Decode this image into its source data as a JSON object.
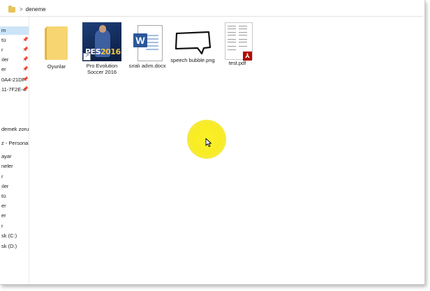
{
  "address": {
    "breadcrumb_separator": ">",
    "current_folder": "deneme"
  },
  "sidebar": {
    "items": [
      {
        "label": "m",
        "selected": true,
        "pinned": false
      },
      {
        "label": "tü",
        "pinned": true
      },
      {
        "label": "r",
        "pinned": true
      },
      {
        "label": "ıler",
        "pinned": true
      },
      {
        "label": "er",
        "pinned": true
      },
      {
        "label": "0A4-21DF",
        "pinned": true
      },
      {
        "label": "11-7F2E-4",
        "pinned": true
      },
      {
        "label": "demek zorun",
        "pinned": false
      },
      {
        "label": "z - Personal",
        "pinned": false
      },
      {
        "label": "ayar",
        "pinned": false
      },
      {
        "label": "neler",
        "pinned": false
      },
      {
        "label": "r",
        "pinned": false
      },
      {
        "label": "ıler",
        "pinned": false
      },
      {
        "label": "tü",
        "pinned": false
      },
      {
        "label": "er",
        "pinned": false
      },
      {
        "label": "er",
        "pinned": false
      },
      {
        "label": "r",
        "pinned": false
      },
      {
        "label": "sk (C:)",
        "pinned": false
      },
      {
        "label": "sk (D:)",
        "pinned": false
      }
    ],
    "pin_glyph": "📌"
  },
  "files": [
    {
      "name": "Oyunlar",
      "type": "folder",
      "icon": "folder-icon"
    },
    {
      "name": "Pro Evolution Soccer 2016",
      "type": "shortcut",
      "icon": "pes-2016-icon",
      "logo_text": "PES",
      "logo_year": "2016"
    },
    {
      "name": "sıralı adım.docx",
      "type": "docx",
      "icon": "word-document-icon",
      "badge": "W"
    },
    {
      "name": "speech bubble.png",
      "type": "png",
      "icon": "speech-bubble-image-icon"
    },
    {
      "name": "test.pdf",
      "type": "pdf",
      "icon": "pdf-document-icon"
    }
  ],
  "colors": {
    "selection": "#cce4f7",
    "folder": "#f7d671",
    "word_blue": "#2b579a",
    "pdf_red": "#b30b00",
    "cursor_highlight": "#fbf128"
  }
}
